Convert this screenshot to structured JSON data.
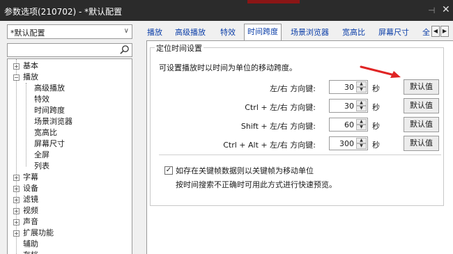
{
  "window": {
    "title": "参数选项(210702) - *默认配置",
    "pin_icon": "pin-icon",
    "close_icon": "close-icon"
  },
  "sidebar": {
    "profile": {
      "value": "*默认配置"
    },
    "search": {
      "value": "",
      "placeholder": ""
    },
    "tree": [
      {
        "label": "基本",
        "expander": "⊞"
      },
      {
        "label": "播放",
        "expander": "⊟",
        "children": [
          "高级播放",
          "特效",
          "时间跨度",
          "场景浏览器",
          "宽高比",
          "屏幕尺寸",
          "全屏",
          "列表"
        ]
      },
      {
        "label": "字幕",
        "expander": "⊞"
      },
      {
        "label": "设备",
        "expander": "⊞"
      },
      {
        "label": "滤镜",
        "expander": "⊞"
      },
      {
        "label": "视频",
        "expander": "⊞"
      },
      {
        "label": "声音",
        "expander": "⊞"
      },
      {
        "label": "扩展功能",
        "expander": "⊞"
      },
      {
        "label": "辅助",
        "expander": ""
      },
      {
        "label": "存档",
        "expander": ""
      }
    ]
  },
  "tabs": [
    "播放",
    "高级播放",
    "特效",
    "时间跨度",
    "场景浏览器",
    "宽高比",
    "屏幕尺寸",
    "全"
  ],
  "selected_tab": "时间跨度",
  "group": {
    "title": "定位时间设置",
    "description": "可设置播放时以时间为单位的移动跨度。",
    "rows": [
      {
        "label": "左/右 方向键:",
        "value": "30",
        "unit": "秒",
        "button": "默认值"
      },
      {
        "label": "Ctrl + 左/右 方向键:",
        "value": "30",
        "unit": "秒",
        "button": "默认值"
      },
      {
        "label": "Shift + 左/右 方向键:",
        "value": "60",
        "unit": "秒",
        "button": "默认值"
      },
      {
        "label": "Ctrl + Alt + 左/右 方向键:",
        "value": "300",
        "unit": "秒",
        "button": "默认值"
      }
    ],
    "checkbox": {
      "label": "如存在关键帧数据则以关键帧为移动单位",
      "checked": true
    },
    "note": "按时间搜索不正确时可用此方式进行快速预览。"
  },
  "annotation": {
    "color": "#e02424"
  }
}
